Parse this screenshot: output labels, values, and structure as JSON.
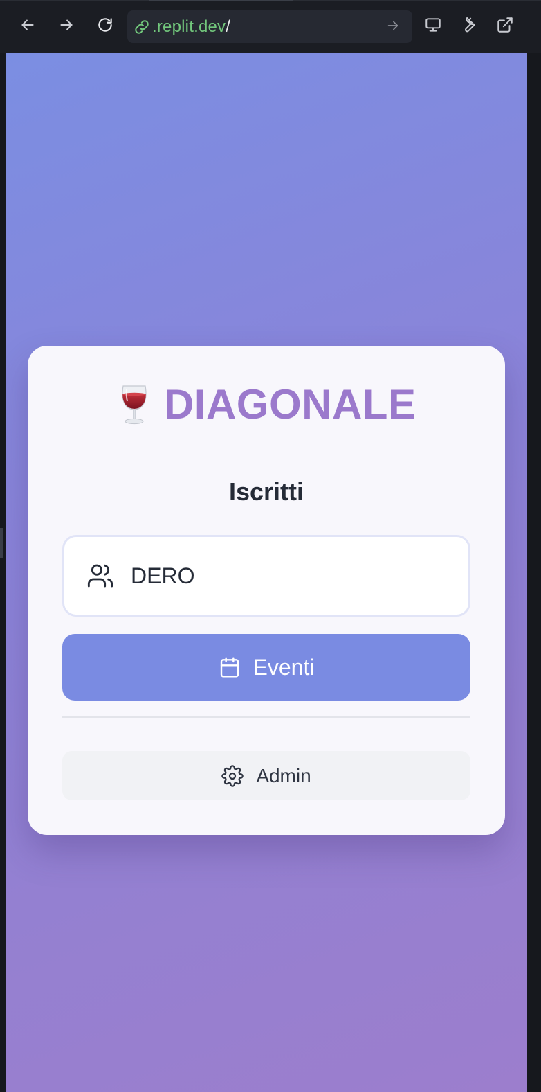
{
  "browser": {
    "url_host": ".replit.dev",
    "url_path": "/",
    "icons": [
      "back-arrow-icon",
      "forward-arrow-icon",
      "reload-icon",
      "link-icon",
      "go-arrow-icon",
      "desktop-icon",
      "wrench-icon",
      "open-external-icon"
    ]
  },
  "brand": {
    "icon": "wine-glass-icon",
    "name": "DIAGONALE"
  },
  "main": {
    "section_title": "Iscritti",
    "select": {
      "icon": "users-icon",
      "value": "DERO"
    },
    "primary_button": {
      "icon": "calendar-icon",
      "label": "Eventi"
    },
    "secondary_button": {
      "icon": "gear-icon",
      "label": "Admin"
    }
  },
  "colors": {
    "brand": "#9b79cc",
    "primary_button": "#7a8be2",
    "url_host": "#72c77c",
    "background_start": "#7b8ee2",
    "background_end": "#9c7ecd"
  }
}
